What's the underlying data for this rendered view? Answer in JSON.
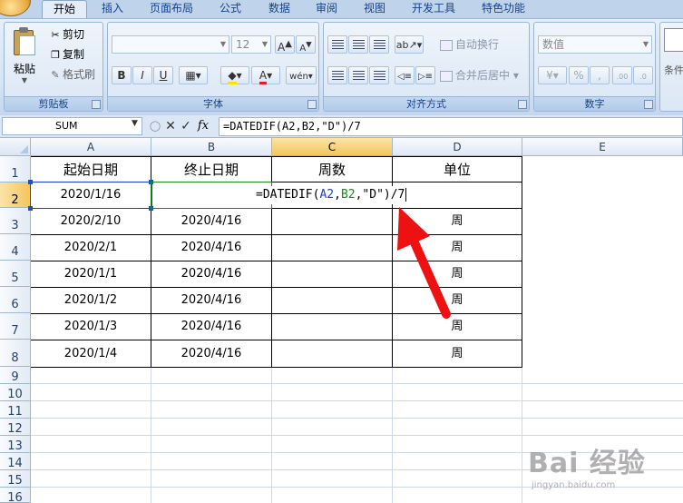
{
  "ribbon": {
    "tabs": [
      "开始",
      "插入",
      "页面布局",
      "公式",
      "数据",
      "审阅",
      "视图",
      "开发工具",
      "特色功能"
    ],
    "clipboard": {
      "paste_label": "粘贴",
      "cut_label": "剪切",
      "copy_label": "复制",
      "format_painter_label": "格式刷",
      "group_label": "剪贴板"
    },
    "font": {
      "font_name": "",
      "font_size": "12",
      "group_label": "字体"
    },
    "alignment": {
      "wrap_label": "自动换行",
      "merge_label": "合并后居中",
      "group_label": "对齐方式"
    },
    "number": {
      "format": "数值",
      "group_label": "数字"
    },
    "partial_label": "条件"
  },
  "formula_bar": {
    "name_box": "SUM",
    "formula": "=DATEDIF(A2,B2,\"D\")/7"
  },
  "grid": {
    "columns": [
      "A",
      "B",
      "C",
      "D",
      "E"
    ],
    "rows": [
      "1",
      "2",
      "3",
      "4",
      "5",
      "6",
      "7",
      "8",
      "9",
      "10",
      "11",
      "12",
      "13",
      "14",
      "15",
      "16"
    ],
    "header": {
      "a": "起始日期",
      "b": "终止日期",
      "c": "周数",
      "d": "单位"
    },
    "data": [
      {
        "a": "2020/1/16",
        "b": "",
        "d": ""
      },
      {
        "a": "2020/2/10",
        "b": "2020/4/16",
        "d": "周"
      },
      {
        "a": "2020/2/1",
        "b": "2020/4/16",
        "d": "周"
      },
      {
        "a": "2020/1/1",
        "b": "2020/4/16",
        "d": "周"
      },
      {
        "a": "2020/1/2",
        "b": "2020/4/16",
        "d": "周"
      },
      {
        "a": "2020/1/3",
        "b": "2020/4/16",
        "d": "周"
      },
      {
        "a": "2020/1/4",
        "b": "2020/4/16",
        "d": "周"
      }
    ],
    "editing_formula": {
      "p1": "=DATEDIF(",
      "ref1": "A2",
      "comma1": ",",
      "ref2": "B2",
      "comma2": ",",
      "p2": "\"D\")/7"
    }
  },
  "colors": {
    "ref_a2": "#1a3fd0",
    "ref_b2": "#1a8a1a",
    "arrow": "#ee1111"
  },
  "watermark": {
    "logo": "Bai 经验",
    "url": "jingyan.baidu.com"
  }
}
